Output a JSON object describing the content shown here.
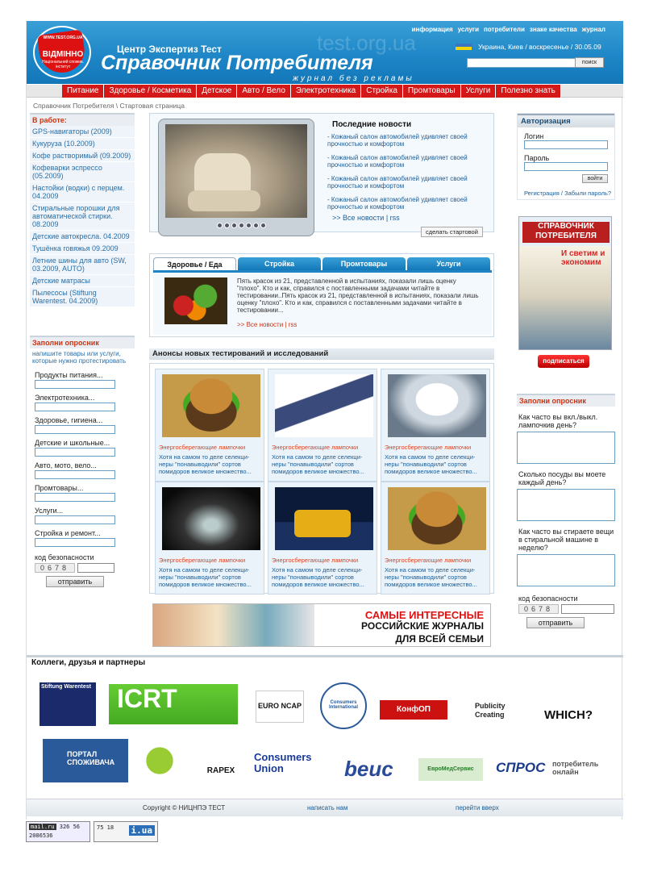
{
  "header": {
    "badge_top": "WWW.TEST.ORG.UA",
    "badge_main": "ВІДМІННО",
    "badge_sub": "Національний спожив. інститут",
    "center_title": "Центр Экспертиз Тест",
    "main_title": "Справочник Потребителя",
    "slogan": "журнал без рекламы",
    "watermark": "test.org.ua",
    "location": "Украина, Киев / воскресенье / 30.05.09",
    "search_button": "поиск"
  },
  "topnav": [
    "информация",
    "услуги",
    "потребители",
    "знаке качества",
    "журнал"
  ],
  "mainnav": [
    "Питание",
    "Здоровье / Косметика",
    "Детское",
    "Авто / Вело",
    "Электротехника",
    "Стройка",
    "Промтовары",
    "Услуги",
    "Полезно знать"
  ],
  "breadcrumb": "Справочник Потребителя \\ Стартовая страница",
  "in_progress": {
    "title": "В работе:",
    "items": [
      "GPS-навигаторы (2009)",
      "Кукуруза (10.2009)",
      "Кофе растворимый (09.2009)",
      "Кофеварки эспрессо (05.2009)",
      "Настойки (водки) с перцем. 04.2009",
      "Стиральные порошки для автоматической стирки. 08.2009",
      "Детские автокресла. 04.2009",
      "Тушёнка говяжья 09.2009",
      "Летние шины для авто (SW, 03.2009, AUTO)",
      "Детские матрасы",
      "Пылесосы (Stiftung Warentest. 04.2009)"
    ]
  },
  "left_survey": {
    "title": "Заполни опросник",
    "hint": "напишите товары или услуги, которые нужно протестировать",
    "fields": [
      "Продукты питания...",
      "Электротехника...",
      "Здоровье, гигиена...",
      "Детские и школьные...",
      "Авто, мото, вело...",
      "Промтовары...",
      "Услуги...",
      "Стройка и ремонт..."
    ],
    "captcha_label": "код безопасности",
    "captcha_code": "0678",
    "submit": "отправить"
  },
  "news": {
    "title": "Последние новости",
    "items": [
      "- Кожаный салон автомобилей удивляет своей прочностью и комфортом",
      "- Кожаный салон автомобилей удивляет своей прочностью и комфортом",
      "- Кожаный салон автомобилей удивляет своей прочностью и комфортом",
      "- Кожаный салон автомобилей удивляет своей прочностью и комфортом"
    ],
    "all_link": ">> Все новости | rss",
    "make_start": "сделать стартовой"
  },
  "tabs": {
    "labels": [
      "Здоровье / Еда",
      "Стройка",
      "Промтовары",
      "Услуги"
    ],
    "text": "Пять красок из 21, представленной в испытаниях, показали лишь оценку \"плохо\". Кто и как, справился с поставленными задачами читайте в тестировании..Пять красок из 21, представленной в испытаниях, показали лишь оценку \"плохо\". Кто и как, справился с поставленными задачами читайте в тестировании...",
    "links": ">> Все новости | rss"
  },
  "announcements": {
    "title": "Анонсы новых тестирований и исследований",
    "cards": [
      {
        "title": "Энергосберегающие лампочки",
        "desc": "Хотя на самом то деле селекци-неры \"понавыводили\" сортов помидоров великое множество..."
      },
      {
        "title": "Энергосберегающие лампочки",
        "desc": "Хотя на самом то деле селекци-неры \"понавыводили\" сортов помидоров великое множество..."
      },
      {
        "title": "Энергосберегающие лампочки",
        "desc": "Хотя на самом то деле селекци-неры \"понавыводили\" сортов помидоров великое множество..."
      },
      {
        "title": "Энергосберегающие лампочки",
        "desc": "Хотя на самом то деле селекци-неры \"понавыводили\" сортов помидоров великое множество..."
      },
      {
        "title": "Энергосберегающие лампочки",
        "desc": "Хотя на самом то деле селекци-неры \"понавыводили\" сортов помидоров великое множество..."
      },
      {
        "title": "Энергосберегающие лампочки",
        "desc": "Хотя на самом то деле селекци-неры \"понавыводили\" сортов помидоров великое множество..."
      }
    ]
  },
  "banner": {
    "line1": "САМЫЕ ИНТЕРЕСНЫЕ",
    "line2": "РОССИЙСКИЕ ЖУРНАЛЫ",
    "line3": "ДЛЯ ВСЕЙ СЕМЬИ"
  },
  "auth": {
    "title": "Авторизация",
    "login": "Логин",
    "password": "Пароль",
    "submit": "войти",
    "links": "Регистрация / Забыли пароль?"
  },
  "magazine": {
    "title": "СПРАВОЧНИК ПОТРЕБИТЕЛЯ",
    "subtitle": "И светим и экономим",
    "subscribe": "подписаться"
  },
  "right_survey": {
    "title": "Заполни опросник",
    "questions": [
      "Как часто вы вкл./выкл. лампочкив день?",
      "Сколько посуды вы моете каждый день?",
      "Как часто вы стираете вещи в стиральной машине в неделю?"
    ],
    "captcha_label": "код безопасности",
    "captcha_code": "0678",
    "submit": "отправить"
  },
  "partners": {
    "title": "Коллеги, друзья и партнеры",
    "logos": [
      "Stiftung Warentest",
      "ICRT",
      "EURO NCAP",
      "Consumers International",
      "КонфОП",
      "Publicity Creating",
      "WHICH?",
      "ПОРТАЛ СПОЖИВАЧА",
      "RAPEX",
      "Consumers Union",
      "beuc",
      "ЕвроМедСервис",
      "СПРОС",
      "потребитель онлайн"
    ]
  },
  "footer": {
    "copyright": "Copyright © НИЦНПЭ ТЕСТ",
    "write": "написать нам",
    "top": "перейти вверх"
  },
  "counters": {
    "mailru": "mail.ru",
    "mail_nums": "326  56",
    "mail_total": "2086536",
    "counter2": "75 18",
    "iua": "i.ua"
  }
}
